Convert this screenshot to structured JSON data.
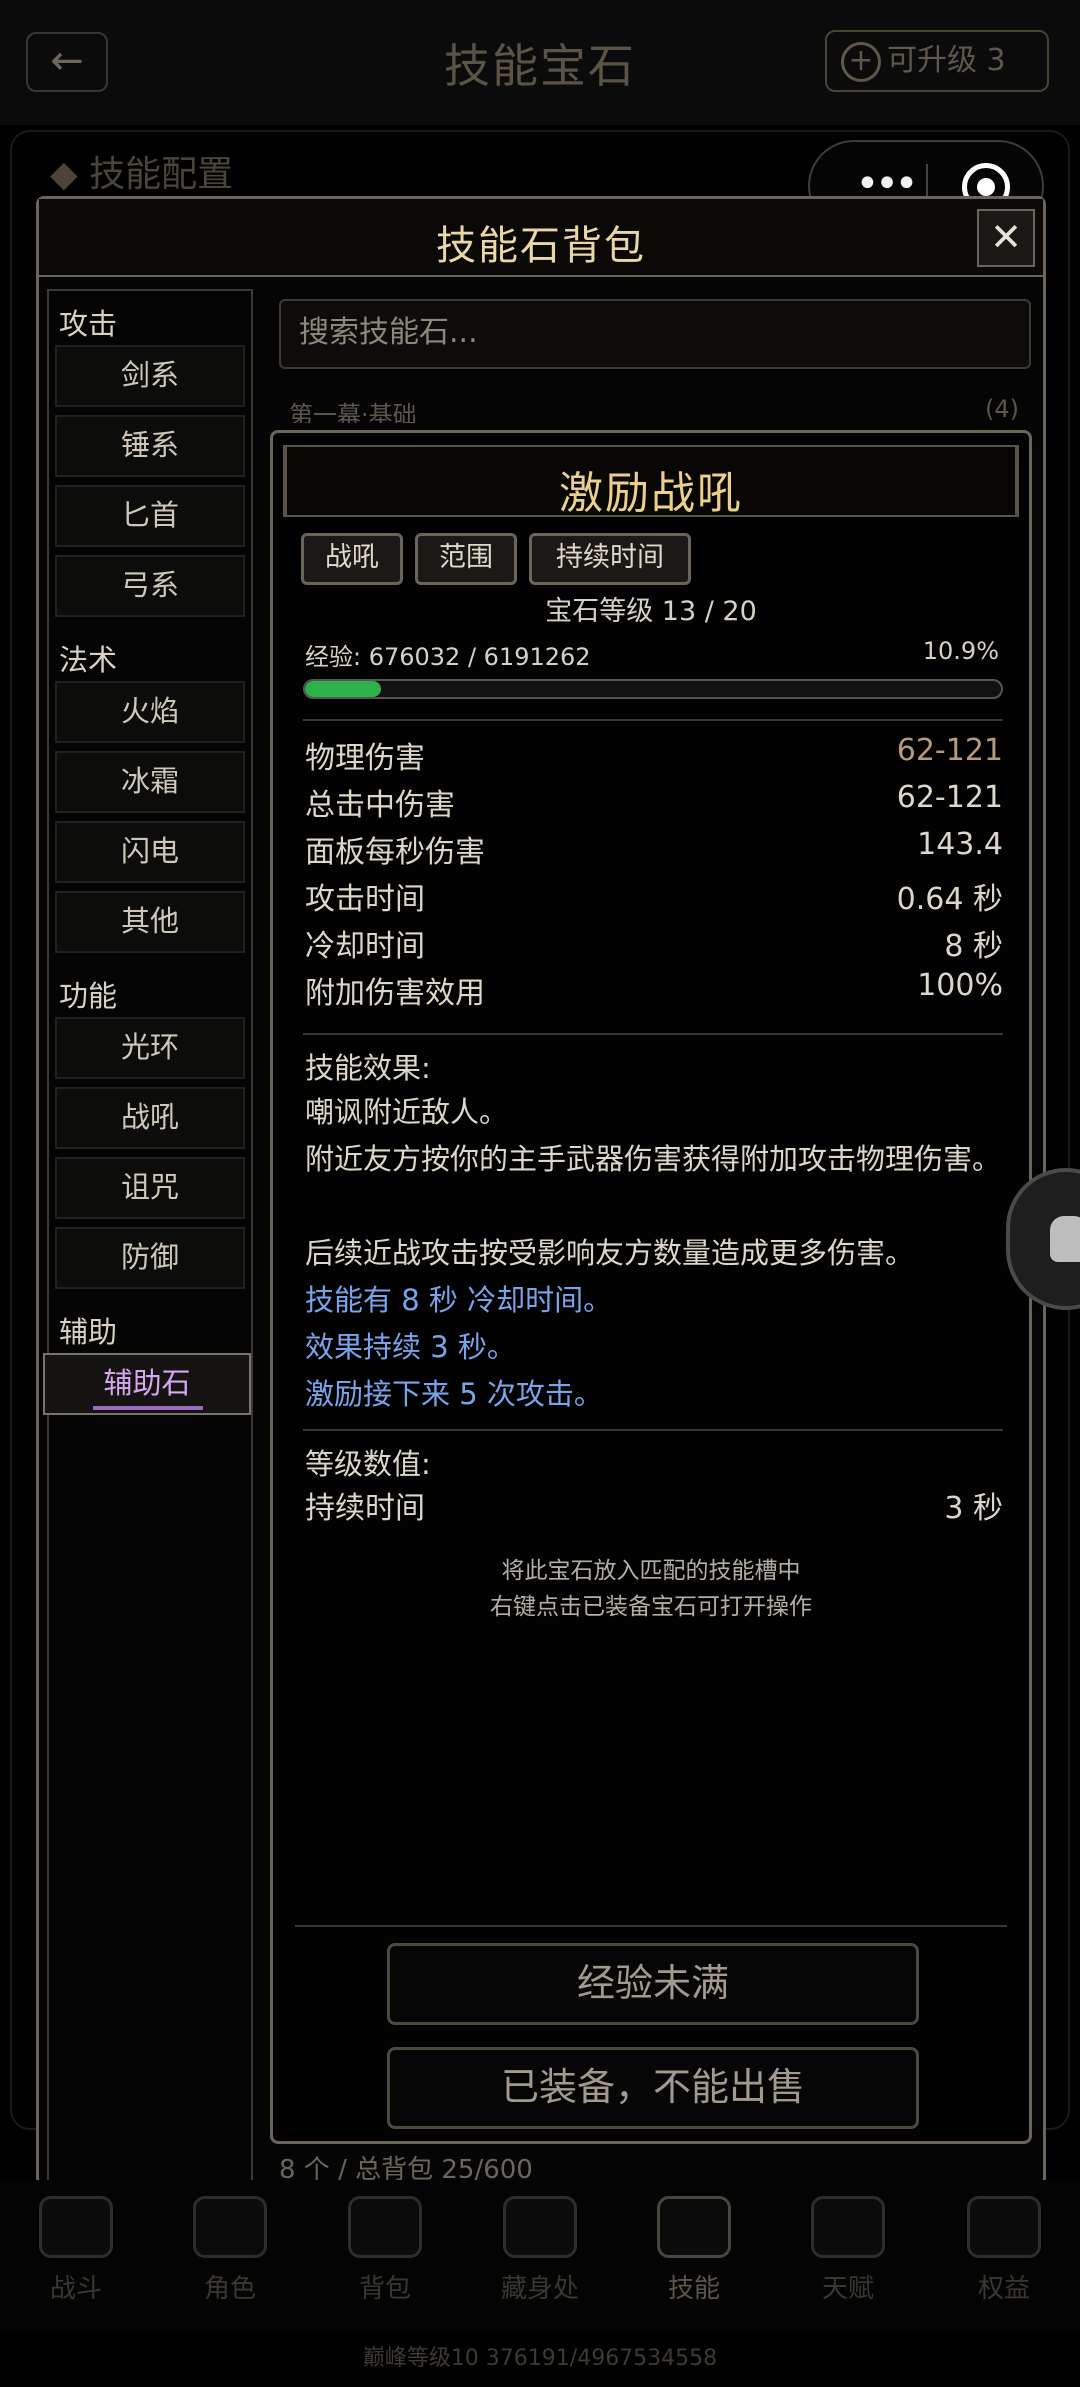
{
  "header": {
    "title": "技能宝石",
    "back_icon": "←",
    "upgrade_label": "可升级 3"
  },
  "config": {
    "label": "◆ 技能配置"
  },
  "capsule": {
    "dots": "•••"
  },
  "bag": {
    "title": "技能石背包",
    "close_icon": "✕",
    "search_placeholder": "搜索技能石...",
    "section_peek": "第一幕·基础",
    "section_peek_count": "(4)",
    "footer_count": "8 个 / 总背包 25/600"
  },
  "sidebar": {
    "categories": [
      {
        "title": "攻击",
        "items": [
          "剑系",
          "锤系",
          "匕首",
          "弓系"
        ]
      },
      {
        "title": "法术",
        "items": [
          "火焰",
          "冰霜",
          "闪电",
          "其他"
        ]
      },
      {
        "title": "功能",
        "items": [
          "光环",
          "战吼",
          "诅咒",
          "防御"
        ]
      },
      {
        "title": "辅助",
        "items": [
          "辅助石"
        ]
      }
    ],
    "active_item": "辅助石"
  },
  "detail": {
    "name": "激励战吼",
    "tags": [
      "战吼",
      "范围",
      "持续时间"
    ],
    "gem_level": "宝石等级 13 / 20",
    "exp_label": "经验: 676032 / 6191262",
    "exp_pct": "10.9%",
    "exp_fraction": 0.109,
    "stats": [
      {
        "k": "物理伤害",
        "v": "62-121",
        "color": "#b79a7a"
      },
      {
        "k": "总击中伤害",
        "v": "62-121",
        "color": "#ddd7ca"
      },
      {
        "k": "面板每秒伤害",
        "v": "143.4",
        "color": "#ddd7ca"
      },
      {
        "k": "攻击时间",
        "v": "0.64 秒",
        "color": "#ddd7ca"
      },
      {
        "k": "冷却时间",
        "v": "8 秒",
        "color": "#ddd7ca"
      },
      {
        "k": "附加伤害效用",
        "v": "100%",
        "color": "#ddd7ca"
      }
    ],
    "effect_title": "技能效果:",
    "effects": [
      {
        "text": "嘲讽附近敌人。",
        "blue": false
      },
      {
        "text": "附近友方按你的主手武器伤害获得附加攻击物理伤害。",
        "blue": false
      },
      {
        "text": "后续近战攻击按受影响友方数量造成更多伤害。",
        "blue": false
      },
      {
        "text": "技能有 8 秒 冷却时间。",
        "blue": true
      },
      {
        "text": "效果持续 3 秒。",
        "blue": true
      },
      {
        "text": "激励接下来 5 次攻击。",
        "blue": true
      }
    ],
    "level_values_title": "等级数值:",
    "level_values": [
      {
        "k": "持续时间",
        "v": "3 秒"
      }
    ],
    "hint1": "将此宝石放入匹配的技能槽中",
    "hint2": "右键点击已装备宝石可打开操作",
    "btn_exp": "经验未满",
    "btn_sell": "已装备，不能出售"
  },
  "bottom_nav": {
    "items": [
      "战斗",
      "角色",
      "背包",
      "藏身处",
      "技能",
      "天赋",
      "权益"
    ],
    "active": "技能",
    "peak_level": "巅峰等级10  376191/4967534558"
  },
  "colors": {
    "gold": "#ebd08b",
    "exp_green": "#2db14a",
    "blue_text": "#79a4ea",
    "active_purple": "#d6a8f0"
  }
}
